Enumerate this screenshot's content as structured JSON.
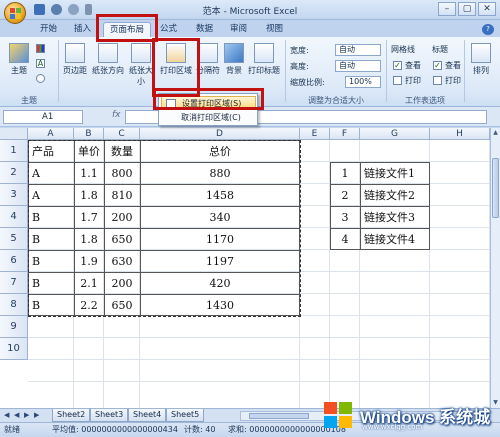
{
  "window": {
    "title": "范本 - Microsoft Excel"
  },
  "ribbon": {
    "tabs": [
      "开始",
      "插入",
      "页面布局",
      "公式",
      "数据",
      "审阅",
      "视图"
    ],
    "active_tab": "页面布局",
    "buttons": {
      "theme": "主题",
      "margins": "页边距",
      "orientation": "纸张方向",
      "size": "纸张大小",
      "print_area": "打印区域",
      "breaks": "分隔符",
      "background": "背景",
      "print_titles": "打印标题",
      "arrange": "排列"
    },
    "scale": {
      "width_label": "宽度:",
      "width_value": "自动",
      "height_label": "高度:",
      "height_value": "自动",
      "scale_label": "缩放比例:",
      "scale_value": "100%"
    },
    "sheet_options": {
      "gridlines": "网格线",
      "headings": "标题",
      "view": "查看",
      "print": "打印"
    },
    "groups": {
      "themes": "主题",
      "scale_to_fit": "调整为合适大小",
      "sheet_options": "工作表选项"
    }
  },
  "dropdown": {
    "items": [
      "设置打印区域(S)",
      "取消打印区域(C)"
    ]
  },
  "formula_bar": {
    "name_box": "A1",
    "fx": "fx"
  },
  "columns": [
    "A",
    "B",
    "C",
    "D",
    "E",
    "F",
    "G",
    "H"
  ],
  "rows": [
    "1",
    "2",
    "3",
    "4",
    "5",
    "6",
    "7",
    "8",
    "9",
    "10"
  ],
  "table_main": {
    "headers": [
      "产品",
      "单价",
      "数量",
      "总价"
    ],
    "rows": [
      [
        "A",
        "1.1",
        "800",
        "880"
      ],
      [
        "A",
        "1.8",
        "810",
        "1458"
      ],
      [
        "B",
        "1.7",
        "200",
        "340"
      ],
      [
        "B",
        "1.8",
        "650",
        "1170"
      ],
      [
        "B",
        "1.9",
        "630",
        "1197"
      ],
      [
        "B",
        "2.1",
        "200",
        "420"
      ],
      [
        "B",
        "2.2",
        "650",
        "1430"
      ]
    ]
  },
  "table_links": {
    "rows": [
      [
        "1",
        "链接文件1"
      ],
      [
        "2",
        "链接文件2"
      ],
      [
        "3",
        "链接文件3"
      ],
      [
        "4",
        "链接文件4"
      ]
    ]
  },
  "sheet_tabs": [
    "Sheet2",
    "Sheet3",
    "Sheet4",
    "Sheet5"
  ],
  "status_bar": {
    "mode": "就绪",
    "average": "平均值: 0000000000000000434",
    "count": "计数: 40",
    "sum": "求和: 0000000000000000108"
  },
  "watermark": {
    "title": "Windows 系统城",
    "url": "www.wxclgg.com"
  }
}
